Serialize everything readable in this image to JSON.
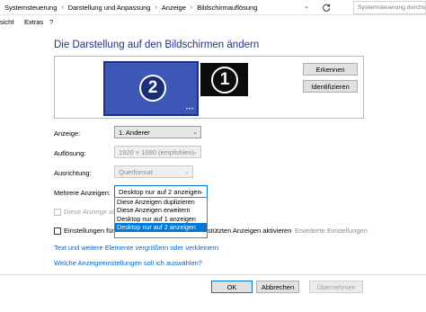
{
  "breadcrumbs": [
    "Systemsteuerung",
    "Darstellung und Anpassung",
    "Anzeige",
    "Bildschirmauflösung"
  ],
  "search": {
    "placeholder": "Systemsteuerung durchsuchen"
  },
  "menu": [
    "sicht",
    "Extras",
    "?"
  ],
  "title": "Die Darstellung auf den Bildschirmen ändern",
  "monitors": {
    "primary_number": "2",
    "secondary_number": "1",
    "dots": "•••"
  },
  "buttons": {
    "identify": "Erkennen",
    "identify2": "Identifizieren",
    "ok": "OK",
    "cancel": "Abbrechen",
    "apply": "Übernehmen"
  },
  "form": {
    "display_label": "Anzeige:",
    "display_value": "1. Anderer",
    "resolution_label": "Auflösung:",
    "resolution_value": "1920 × 1080 (empfohlen)",
    "orientation_label": "Ausrichtung:",
    "orientation_value": "Querformat",
    "multi_label": "Mehrere Anzeigen:",
    "multi_value": "Desktop nur auf 2 anzeigen"
  },
  "dropdown_options": [
    "Diese Anzeigen duplizieren",
    "Diese Anzeigen erweitern",
    "Desktop nur auf 1 anzeigen",
    "Desktop nur auf 2 anzeigen"
  ],
  "checkboxes": {
    "main_display": "Diese Anzeige als",
    "settings_prefix": "Einstellungen für",
    "settings_suffix": "stützten Anzeigen aktivieren",
    "advanced": "Erweiterte Einstellungen"
  },
  "links": {
    "text_size": "Text und weitere Elemente vergrößern oder verkleinern",
    "which_settings": "Welche Anzeigeeinstellungen soll ich auswählen?"
  },
  "colors": {
    "title": "#1e3287",
    "link": "#0066cc",
    "selection": "#0078d7",
    "monitor_primary": "#3d57b6",
    "monitor_secondary": "#0c0c0c"
  }
}
